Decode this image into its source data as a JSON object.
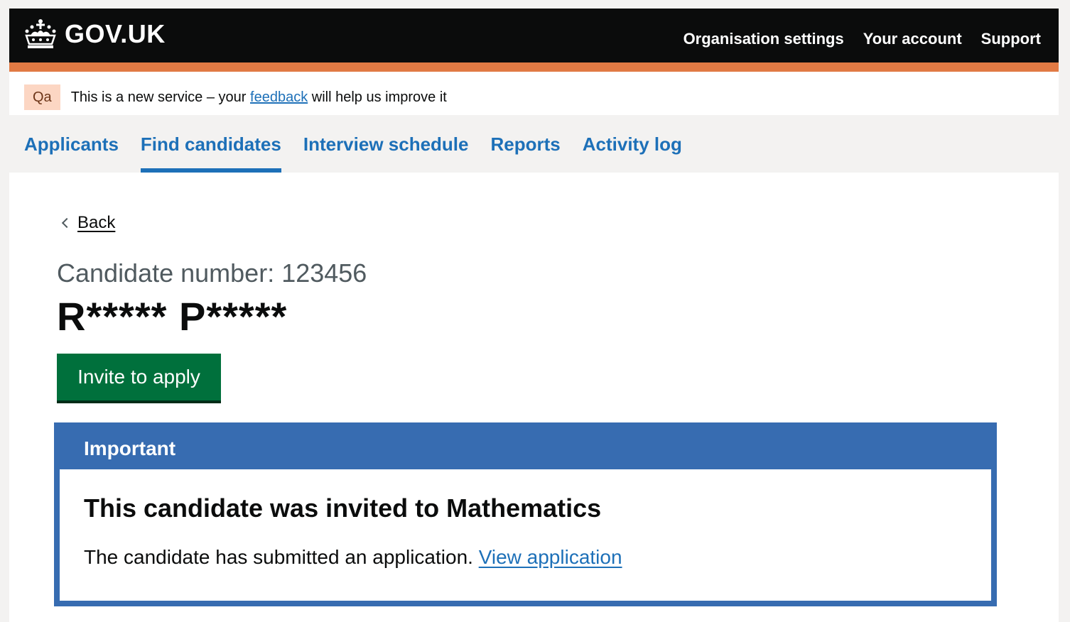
{
  "header": {
    "logo_text": "GOV.UK",
    "nav": [
      "Organisation settings",
      "Your account",
      "Support"
    ],
    "accent_color": "#e17a44"
  },
  "phase": {
    "tag": "Qa",
    "text_before": "This is a new service – your ",
    "link": "feedback",
    "text_after": " will help us improve it"
  },
  "subnav": {
    "items": [
      {
        "label": "Applicants"
      },
      {
        "label": "Find candidates",
        "active": true
      },
      {
        "label": "Interview schedule"
      },
      {
        "label": "Reports"
      },
      {
        "label": "Activity log"
      }
    ]
  },
  "main": {
    "back_label": "Back",
    "caption": "Candidate number: 123456",
    "title": "R***** P*****",
    "invite_button": "Invite to apply"
  },
  "notice": {
    "header": "Important",
    "heading": "This candidate was invited to Mathematics",
    "text": "The candidate has submitted an application. ",
    "link": "View application"
  }
}
